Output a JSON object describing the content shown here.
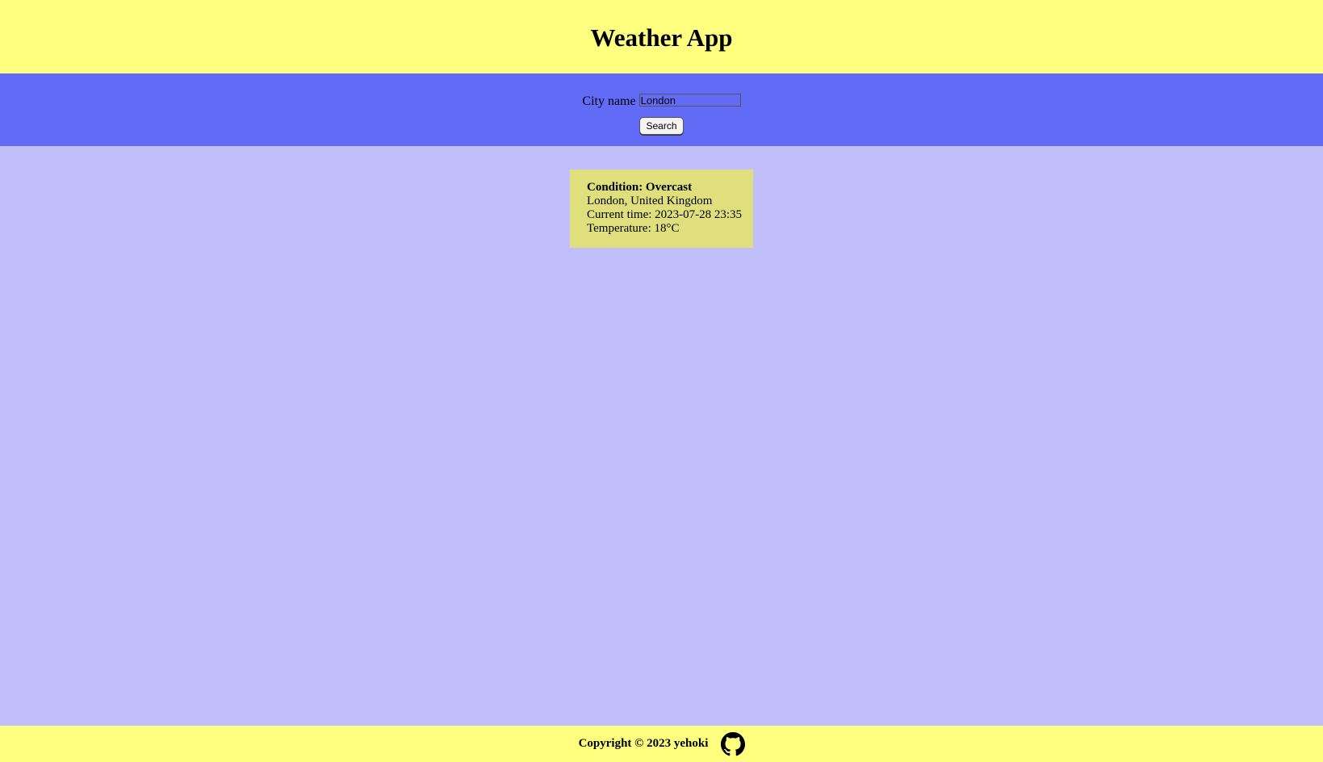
{
  "header": {
    "title": "Weather App"
  },
  "search": {
    "label": "City name",
    "value": "London",
    "button_label": "Search"
  },
  "weather": {
    "condition": "Condition: Overcast",
    "location": "London, United Kingdom",
    "current_time": "Current time: 2023-07-28 23:35",
    "temperature": "Temperature: 18°C"
  },
  "footer": {
    "copyright": "Copyright © 2023 yehoki",
    "github_icon": "github-icon"
  },
  "colors": {
    "header_bg": "#ffff80",
    "search_bg": "#616bf6",
    "page_bg": "#c0bffa",
    "card_bg": "#dfdf7e",
    "footer_bg": "#ffff80"
  }
}
